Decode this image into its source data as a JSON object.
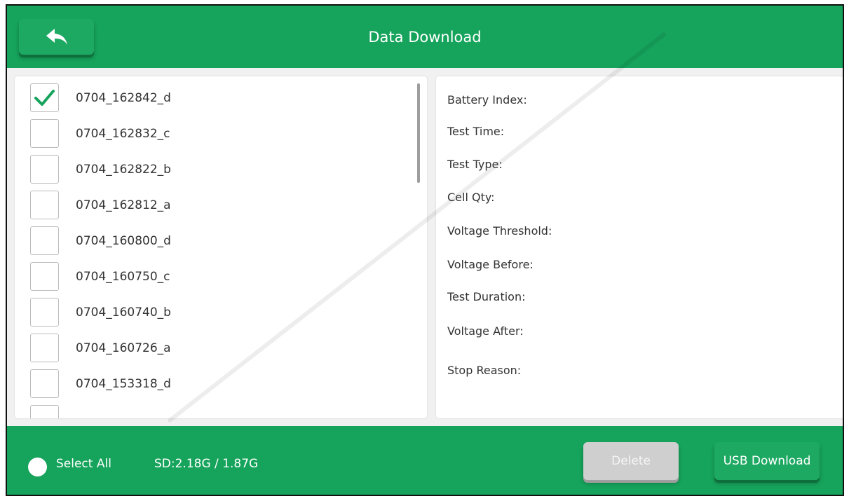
{
  "header": {
    "title": "Data Download",
    "back_icon": "back-arrow-icon"
  },
  "file_list": {
    "items": [
      {
        "label": "0704_162842_d",
        "checked": true
      },
      {
        "label": "0704_162832_c",
        "checked": false
      },
      {
        "label": "0704_162822_b",
        "checked": false
      },
      {
        "label": "0704_162812_a",
        "checked": false
      },
      {
        "label": "0704_160800_d",
        "checked": false
      },
      {
        "label": "0704_160750_c",
        "checked": false
      },
      {
        "label": "0704_160740_b",
        "checked": false
      },
      {
        "label": "0704_160726_a",
        "checked": false
      },
      {
        "label": "0704_153318_d",
        "checked": false
      },
      {
        "label": "",
        "checked": false
      }
    ]
  },
  "details": {
    "battery_index": "Battery Index:",
    "test_time": "Test Time:",
    "test_type": "Test Type:",
    "cell_qty": "Cell Qty:",
    "voltage_threshold": "Voltage Threshold:",
    "voltage_before": "Voltage Before:",
    "test_duration": "Test Duration:",
    "voltage_after": "Voltage After:",
    "stop_reason": "Stop Reason:"
  },
  "footer": {
    "select_all_label": "Select All",
    "sd_info": "SD:2.18G / 1.87G",
    "delete_label": "Delete",
    "usb_download_label": "USB Download"
  },
  "colors": {
    "header_green": "#16a35b",
    "check_green": "#16a35b",
    "disabled_gray": "#cfcfcf"
  }
}
